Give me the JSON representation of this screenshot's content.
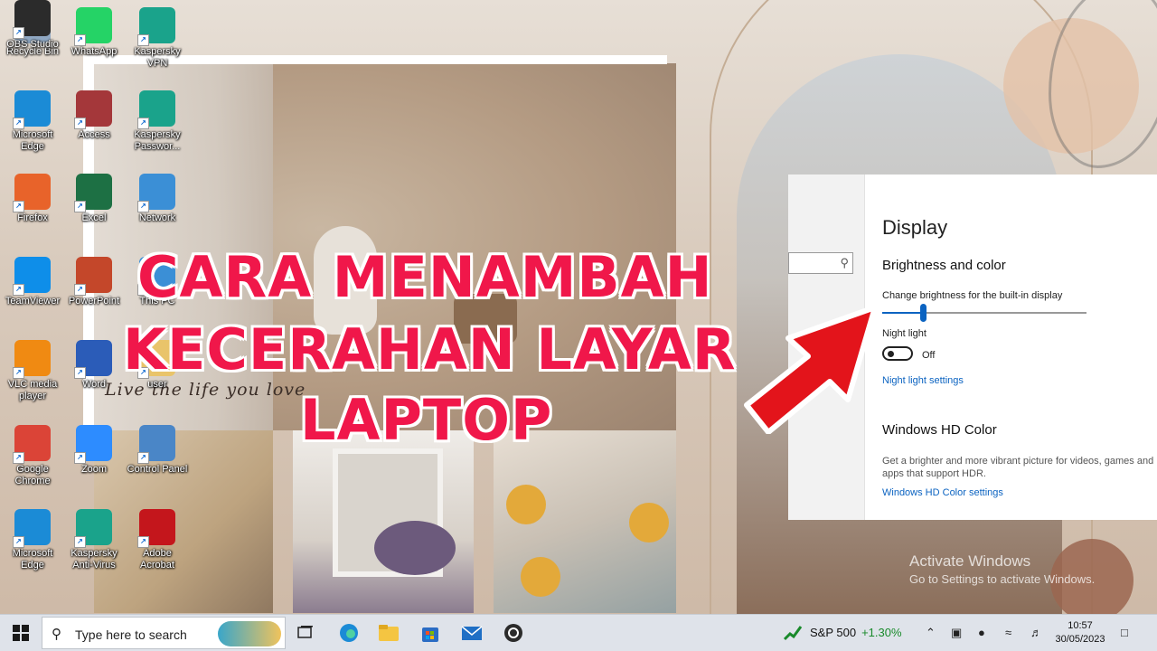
{
  "desktop_icons": [
    {
      "label": "Recycle Bin",
      "icon": "recycle-bin-icon",
      "color": "#8fa7c2"
    },
    {
      "label": "WhatsApp",
      "icon": "whatsapp-icon",
      "color": "#25d366"
    },
    {
      "label": "Kaspersky VPN",
      "icon": "kaspersky-vpn-icon",
      "color": "#1aa38b"
    },
    {
      "label": "Microsoft Edge",
      "icon": "edge-icon",
      "color": "#1b8bd6"
    },
    {
      "label": "Access",
      "icon": "access-icon",
      "color": "#a4373a"
    },
    {
      "label": "Kaspersky Passwor...",
      "icon": "kaspersky-password-icon",
      "color": "#1aa38b"
    },
    {
      "label": "Firefox",
      "icon": "firefox-icon",
      "color": "#e8632a"
    },
    {
      "label": "Excel",
      "icon": "excel-icon",
      "color": "#1d7044"
    },
    {
      "label": "Network",
      "icon": "network-icon",
      "color": "#3b8fd6"
    },
    {
      "label": "TeamViewer",
      "icon": "teamviewer-icon",
      "color": "#0e8ee9"
    },
    {
      "label": "PowerPoint",
      "icon": "powerpoint-icon",
      "color": "#c4472a"
    },
    {
      "label": "This PC",
      "icon": "this-pc-icon",
      "color": "#3b8fd6"
    },
    {
      "label": "VLC media player",
      "icon": "vlc-icon",
      "color": "#f08a12"
    },
    {
      "label": "Word",
      "icon": "word-icon",
      "color": "#2b5cb8"
    },
    {
      "label": "user",
      "icon": "user-folder-icon",
      "color": "#e9c46a"
    },
    {
      "label": "Google Chrome",
      "icon": "chrome-icon",
      "color": "#db4437"
    },
    {
      "label": "Zoom",
      "icon": "zoom-icon",
      "color": "#2d8cff"
    },
    {
      "label": "Control Panel",
      "icon": "control-panel-icon",
      "color": "#4a86c7"
    },
    {
      "label": "Microsoft Edge",
      "icon": "edge-icon",
      "color": "#1b8bd6"
    },
    {
      "label": "Kaspersky Anti-Virus",
      "icon": "kaspersky-antivirus-icon",
      "color": "#1aa38b"
    },
    {
      "label": "Adobe Acrobat",
      "icon": "acrobat-icon",
      "color": "#c4161c"
    },
    {
      "label": "OBS Studio",
      "icon": "obs-icon",
      "color": "#2b2b2b"
    }
  ],
  "wallpaper": {
    "script_text": "Live the life you love"
  },
  "title_overlay": {
    "line1": "CARA MENAMBAH",
    "line2": "KECERAHAN LAYAR",
    "line3": "LAPTOP",
    "color": "#f0174a"
  },
  "settings": {
    "page_title": "Display",
    "section_brightness": "Brightness and color",
    "brightness_label": "Change brightness for the built-in display",
    "brightness_level": 0.2,
    "night_light_label": "Night light",
    "night_light_state": "Off",
    "night_light_settings_link": "Night light settings",
    "section_hd": "Windows HD Color",
    "hd_description": "Get a brighter and more vibrant picture for videos, games and apps that support HDR.",
    "hd_settings_link": "Windows HD Color settings",
    "accent_color": "#0b63c1"
  },
  "watermark": {
    "line1": "Activate Windows",
    "line2": "Go to Settings to activate Windows."
  },
  "taskbar": {
    "search_placeholder": "Type here to search",
    "apps": [
      "task-view-icon",
      "edge-icon",
      "file-explorer-icon",
      "microsoft-store-icon",
      "mail-icon",
      "obs-icon"
    ],
    "stock_name": "S&P 500",
    "stock_change": "+1.30%",
    "time": "10:57",
    "date": "30/05/2023"
  }
}
